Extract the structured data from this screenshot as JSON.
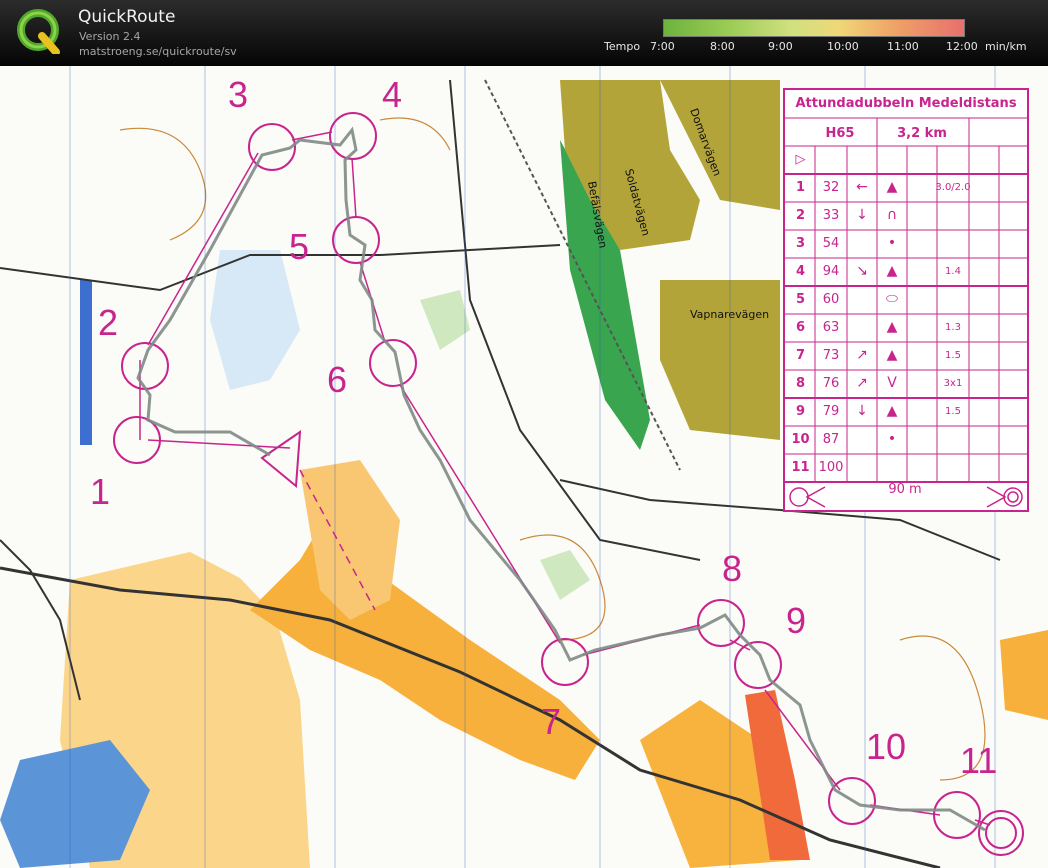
{
  "app": {
    "title": "QuickRoute",
    "version": "Version 2.4",
    "url": "matstroeng.se/quickroute/sv"
  },
  "tempo_scale": {
    "label": "Tempo",
    "ticks": [
      "7:00",
      "8:00",
      "9:00",
      "10:00",
      "11:00",
      "12:00"
    ],
    "unit": "min/km",
    "colors": [
      "#6cb33e",
      "#cfe080",
      "#f0d878",
      "#e8706e"
    ]
  },
  "control_card": {
    "title": "Attundadubbeln Medeldistans",
    "class_name": "H65",
    "length": "3,2 km",
    "start_symbol": "▷",
    "controls": [
      {
        "num": "1",
        "code": "32",
        "dir": "←",
        "feature": "▲",
        "dim": "3.0/2.0"
      },
      {
        "num": "2",
        "code": "33",
        "dir": "↓",
        "feature": "∩",
        "dim": ""
      },
      {
        "num": "3",
        "code": "54",
        "dir": "",
        "feature": "•",
        "dim": ""
      },
      {
        "num": "4",
        "code": "94",
        "dir": "↘",
        "feature": "▲",
        "dim": "1.4"
      },
      {
        "num": "5",
        "code": "60",
        "dir": "",
        "feature": "⬭",
        "dim": ""
      },
      {
        "num": "6",
        "code": "63",
        "dir": "",
        "feature": "▲",
        "dim": "1.3"
      },
      {
        "num": "7",
        "code": "73",
        "dir": "↗",
        "feature": "▲",
        "dim": "1.5"
      },
      {
        "num": "8",
        "code": "76",
        "dir": "↗",
        "feature": "V",
        "dim": "3x1"
      },
      {
        "num": "9",
        "code": "79",
        "dir": "↓",
        "feature": "▲",
        "dim": "1.5"
      },
      {
        "num": "10",
        "code": "87",
        "dir": "",
        "feature": "•",
        "dim": ""
      },
      {
        "num": "11",
        "code": "100",
        "dir": "",
        "feature": "",
        "dim": ""
      }
    ],
    "finish_distance": "90 m"
  },
  "map": {
    "street_labels": [
      "Domarvägen",
      "Soldatvägen",
      "Befälsvägen",
      "Vapnarevägen"
    ],
    "control_numbers": [
      {
        "id": "1",
        "label": "1"
      },
      {
        "id": "2",
        "label": "2"
      },
      {
        "id": "3",
        "label": "3"
      },
      {
        "id": "4",
        "label": "4"
      },
      {
        "id": "5",
        "label": "5"
      },
      {
        "id": "6",
        "label": "6"
      },
      {
        "id": "7",
        "label": "7"
      },
      {
        "id": "8",
        "label": "8"
      },
      {
        "id": "9",
        "label": "9"
      },
      {
        "id": "10",
        "label": "10"
      },
      {
        "id": "11",
        "label": "11"
      }
    ]
  }
}
